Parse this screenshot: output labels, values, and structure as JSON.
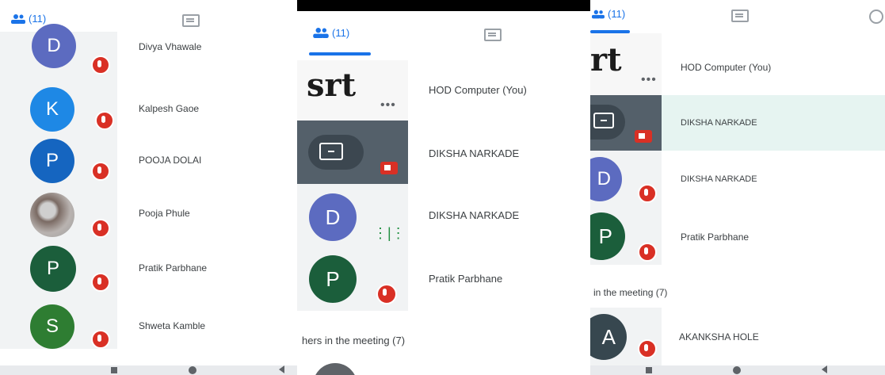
{
  "panel1": {
    "tabs": {
      "people_count": "(11)"
    },
    "participants": [
      {
        "initial": "D",
        "color": "#5c6bc0",
        "name": "Divya Vhawale"
      },
      {
        "initial": "K",
        "color": "#1e88e5",
        "name": "Kalpesh Gaoe"
      },
      {
        "initial": "P",
        "color": "#1565c0",
        "name": "POOJA DOLAI"
      },
      {
        "initial": "",
        "color": "#9e9e9e",
        "name": "Pooja Phule"
      },
      {
        "initial": "P",
        "color": "#1b5e3b",
        "name": "Pratik Parbhane"
      },
      {
        "initial": "S",
        "color": "#2e7d32",
        "name": "Shweta Kamble"
      }
    ]
  },
  "panel2": {
    "tabs": {
      "people_count": "(11)"
    },
    "participants": [
      {
        "tile": "srt",
        "logo_text": "srt",
        "name": "HOD Computer (You)"
      },
      {
        "tile": "screen",
        "name": "DIKSHA NARKADE"
      },
      {
        "initial": "D",
        "color": "#5c6bc0",
        "name": "DIKSHA NARKADE"
      },
      {
        "initial": "P",
        "color": "#1b5e3b",
        "name": "Pratik Parbhane"
      }
    ],
    "section": "hers in the meeting (7)"
  },
  "panel3": {
    "tabs": {
      "people_count": "(11)"
    },
    "participants": [
      {
        "tile": "srt",
        "logo_text": "rt",
        "name": "HOD Computer (You)"
      },
      {
        "tile": "screen",
        "name": "DIKSHA NARKADE"
      },
      {
        "initial": "D",
        "color": "#5c6bc0",
        "name": "DIKSHA NARKADE"
      },
      {
        "initial": "P",
        "color": "#1b5e3b",
        "name": "Pratik Parbhane"
      }
    ],
    "section": "in the meeting (7)",
    "participants2": [
      {
        "initial": "A",
        "color": "#37474f",
        "name": "AKANKSHA HOLE"
      }
    ]
  }
}
